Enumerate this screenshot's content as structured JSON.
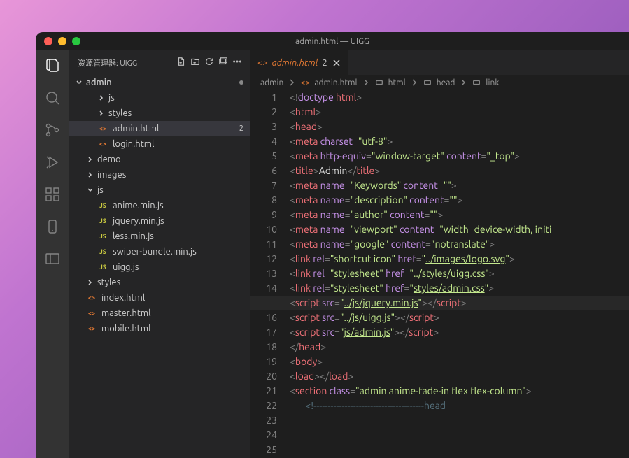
{
  "window_title": "admin.html — UIGG",
  "explorer": {
    "label": "资源管理器: UIGG",
    "root": "admin",
    "tree": [
      {
        "type": "folder",
        "name": "js",
        "depth": 2,
        "open": false
      },
      {
        "type": "folder",
        "name": "styles",
        "depth": 2,
        "open": false
      },
      {
        "type": "file",
        "name": "admin.html",
        "depth": 2,
        "icon": "html",
        "selected": true,
        "badge": "2"
      },
      {
        "type": "file",
        "name": "login.html",
        "depth": 2,
        "icon": "html"
      },
      {
        "type": "folder",
        "name": "demo",
        "depth": 1,
        "open": false
      },
      {
        "type": "folder",
        "name": "images",
        "depth": 1,
        "open": false
      },
      {
        "type": "folder",
        "name": "js",
        "depth": 1,
        "open": true
      },
      {
        "type": "file",
        "name": "anime.min.js",
        "depth": 2,
        "icon": "js"
      },
      {
        "type": "file",
        "name": "jquery.min.js",
        "depth": 2,
        "icon": "js"
      },
      {
        "type": "file",
        "name": "less.min.js",
        "depth": 2,
        "icon": "js"
      },
      {
        "type": "file",
        "name": "swiper-bundle.min.js",
        "depth": 2,
        "icon": "js"
      },
      {
        "type": "file",
        "name": "uigg.js",
        "depth": 2,
        "icon": "js"
      },
      {
        "type": "folder",
        "name": "styles",
        "depth": 1,
        "open": false
      },
      {
        "type": "file",
        "name": "index.html",
        "depth": 1,
        "icon": "html"
      },
      {
        "type": "file",
        "name": "master.html",
        "depth": 1,
        "icon": "html"
      },
      {
        "type": "file",
        "name": "mobile.html",
        "depth": 1,
        "icon": "html"
      }
    ]
  },
  "tab": {
    "name": "admin.html",
    "badge": "2"
  },
  "breadcrumbs": [
    "admin",
    "admin.html",
    "html",
    "head",
    "link"
  ],
  "code": {
    "current_line": 15,
    "lines": [
      {
        "n": 1,
        "t": [
          [
            "p",
            "<!"
          ],
          [
            "dt",
            "doctype"
          ],
          [
            "d",
            " "
          ],
          [
            "tag",
            "html"
          ],
          [
            "p",
            ">"
          ]
        ]
      },
      {
        "n": 2,
        "t": [
          [
            "p",
            "<"
          ],
          [
            "tag",
            "html"
          ],
          [
            "p",
            ">"
          ]
        ]
      },
      {
        "n": 3,
        "t": [
          [
            "p",
            "<"
          ],
          [
            "tag",
            "head"
          ],
          [
            "p",
            ">"
          ]
        ]
      },
      {
        "n": 4,
        "t": [
          [
            "p",
            "<"
          ],
          [
            "tag",
            "meta"
          ],
          [
            "d",
            " "
          ],
          [
            "attr",
            "charset"
          ],
          [
            "p",
            "="
          ],
          [
            "str",
            "\"utf-8\""
          ],
          [
            "p",
            ">"
          ]
        ]
      },
      {
        "n": 5,
        "t": [
          [
            "p",
            "<"
          ],
          [
            "tag",
            "meta"
          ],
          [
            "d",
            " "
          ],
          [
            "attr",
            "http-equiv"
          ],
          [
            "p",
            "="
          ],
          [
            "str",
            "\"window-target\""
          ],
          [
            "d",
            " "
          ],
          [
            "attr",
            "content"
          ],
          [
            "p",
            "="
          ],
          [
            "str",
            "\"_top\""
          ],
          [
            "p",
            ">"
          ]
        ]
      },
      {
        "n": 6,
        "t": [
          [
            "p",
            "<"
          ],
          [
            "tag",
            "title"
          ],
          [
            "p",
            ">"
          ],
          [
            "d",
            "Admin"
          ],
          [
            "p",
            "</"
          ],
          [
            "tag",
            "title"
          ],
          [
            "p",
            ">"
          ]
        ]
      },
      {
        "n": 7,
        "t": [
          [
            "p",
            "<"
          ],
          [
            "tag",
            "meta"
          ],
          [
            "d",
            " "
          ],
          [
            "attr",
            "name"
          ],
          [
            "p",
            "="
          ],
          [
            "str",
            "\"Keywords\""
          ],
          [
            "d",
            " "
          ],
          [
            "attr",
            "content"
          ],
          [
            "p",
            "="
          ],
          [
            "str",
            "\"\""
          ],
          [
            "p",
            ">"
          ]
        ]
      },
      {
        "n": 8,
        "t": [
          [
            "p",
            "<"
          ],
          [
            "tag",
            "meta"
          ],
          [
            "d",
            " "
          ],
          [
            "attr",
            "name"
          ],
          [
            "p",
            "="
          ],
          [
            "str",
            "\"description\""
          ],
          [
            "d",
            " "
          ],
          [
            "attr",
            "content"
          ],
          [
            "p",
            "="
          ],
          [
            "str",
            "\"\""
          ],
          [
            "p",
            ">"
          ]
        ]
      },
      {
        "n": 9,
        "t": [
          [
            "p",
            "<"
          ],
          [
            "tag",
            "meta"
          ],
          [
            "d",
            " "
          ],
          [
            "attr",
            "name"
          ],
          [
            "p",
            "="
          ],
          [
            "str",
            "\"author\""
          ],
          [
            "d",
            " "
          ],
          [
            "attr",
            "content"
          ],
          [
            "p",
            "="
          ],
          [
            "str",
            "\"\""
          ],
          [
            "p",
            ">"
          ]
        ]
      },
      {
        "n": 10,
        "t": [
          [
            "p",
            "<"
          ],
          [
            "tag",
            "meta"
          ],
          [
            "d",
            " "
          ],
          [
            "attr",
            "name"
          ],
          [
            "p",
            "="
          ],
          [
            "str",
            "\"viewport\""
          ],
          [
            "d",
            " "
          ],
          [
            "attr",
            "content"
          ],
          [
            "p",
            "="
          ],
          [
            "str",
            "\"width=device-width, initi"
          ]
        ]
      },
      {
        "n": 11,
        "t": [
          [
            "p",
            "<"
          ],
          [
            "tag",
            "meta"
          ],
          [
            "d",
            " "
          ],
          [
            "attr",
            "name"
          ],
          [
            "p",
            "="
          ],
          [
            "str",
            "\"google\""
          ],
          [
            "d",
            " "
          ],
          [
            "attr",
            "content"
          ],
          [
            "p",
            "="
          ],
          [
            "str",
            "\"notranslate\""
          ],
          [
            "p",
            ">"
          ]
        ]
      },
      {
        "n": 12,
        "t": []
      },
      {
        "n": 13,
        "t": [
          [
            "p",
            "<"
          ],
          [
            "tag",
            "link"
          ],
          [
            "d",
            " "
          ],
          [
            "attr",
            "rel"
          ],
          [
            "p",
            "="
          ],
          [
            "str",
            "\"shortcut icon\""
          ],
          [
            "d",
            " "
          ],
          [
            "attr",
            "href"
          ],
          [
            "p",
            "="
          ],
          [
            "str",
            "\""
          ],
          [
            "lnk",
            "../images/logo.svg"
          ],
          [
            "str",
            "\""
          ],
          [
            "p",
            ">"
          ]
        ]
      },
      {
        "n": 14,
        "t": [
          [
            "p",
            "<"
          ],
          [
            "tag",
            "link"
          ],
          [
            "d",
            " "
          ],
          [
            "attr",
            "rel"
          ],
          [
            "p",
            "="
          ],
          [
            "str",
            "\"stylesheet\""
          ],
          [
            "d",
            " "
          ],
          [
            "attr",
            "href"
          ],
          [
            "p",
            "="
          ],
          [
            "str",
            "\""
          ],
          [
            "lnk",
            "../styles/uigg.css"
          ],
          [
            "str",
            "\""
          ],
          [
            "p",
            ">"
          ]
        ]
      },
      {
        "n": 15,
        "t": [
          [
            "p",
            "<"
          ],
          [
            "tag",
            "link"
          ],
          [
            "d",
            " "
          ],
          [
            "attr",
            "rel"
          ],
          [
            "p",
            "="
          ],
          [
            "str",
            "\"stylesheet\""
          ],
          [
            "d",
            " "
          ],
          [
            "attr",
            "href"
          ],
          [
            "p",
            "="
          ],
          [
            "str",
            "\""
          ],
          [
            "lnk",
            "styles/admin.css"
          ],
          [
            "str",
            "\""
          ],
          [
            "p",
            ">"
          ]
        ]
      },
      {
        "n": 16,
        "t": []
      },
      {
        "n": 17,
        "t": [
          [
            "p",
            "<"
          ],
          [
            "tag",
            "script"
          ],
          [
            "d",
            " "
          ],
          [
            "attr",
            "src"
          ],
          [
            "p",
            "="
          ],
          [
            "str",
            "\""
          ],
          [
            "lnk",
            "../js/jquery.min.js"
          ],
          [
            "str",
            "\""
          ],
          [
            "p",
            "></"
          ],
          [
            "tag",
            "script"
          ],
          [
            "p",
            ">"
          ]
        ]
      },
      {
        "n": 18,
        "t": [
          [
            "p",
            "<"
          ],
          [
            "tag",
            "script"
          ],
          [
            "d",
            " "
          ],
          [
            "attr",
            "src"
          ],
          [
            "p",
            "="
          ],
          [
            "str",
            "\""
          ],
          [
            "lnk",
            "../js/uigg.js"
          ],
          [
            "str",
            "\""
          ],
          [
            "p",
            "></"
          ],
          [
            "tag",
            "script"
          ],
          [
            "p",
            ">"
          ]
        ]
      },
      {
        "n": 19,
        "t": [
          [
            "p",
            "<"
          ],
          [
            "tag",
            "script"
          ],
          [
            "d",
            " "
          ],
          [
            "attr",
            "src"
          ],
          [
            "p",
            "="
          ],
          [
            "str",
            "\""
          ],
          [
            "lnk",
            "js/admin.js"
          ],
          [
            "str",
            "\""
          ],
          [
            "p",
            "></"
          ],
          [
            "tag",
            "script"
          ],
          [
            "p",
            ">"
          ]
        ]
      },
      {
        "n": 20,
        "t": [
          [
            "p",
            "</"
          ],
          [
            "tag",
            "head"
          ],
          [
            "p",
            ">"
          ]
        ]
      },
      {
        "n": 21,
        "t": []
      },
      {
        "n": 22,
        "t": [
          [
            "p",
            "<"
          ],
          [
            "tag",
            "body"
          ],
          [
            "p",
            ">"
          ]
        ]
      },
      {
        "n": 23,
        "t": [
          [
            "p",
            "<"
          ],
          [
            "tag",
            "load"
          ],
          [
            "p",
            "></"
          ],
          [
            "tag",
            "load"
          ],
          [
            "p",
            ">"
          ]
        ]
      },
      {
        "n": 24,
        "t": [
          [
            "p",
            "<"
          ],
          [
            "tag",
            "section"
          ],
          [
            "d",
            " "
          ],
          [
            "attr",
            "class"
          ],
          [
            "p",
            "="
          ],
          [
            "str",
            "\"admin anime-fade-in flex flex-column\""
          ],
          [
            "p",
            ">"
          ]
        ]
      },
      {
        "n": 25,
        "t": [
          [
            "cm",
            "  <!---------------------------------------head"
          ]
        ]
      }
    ]
  }
}
